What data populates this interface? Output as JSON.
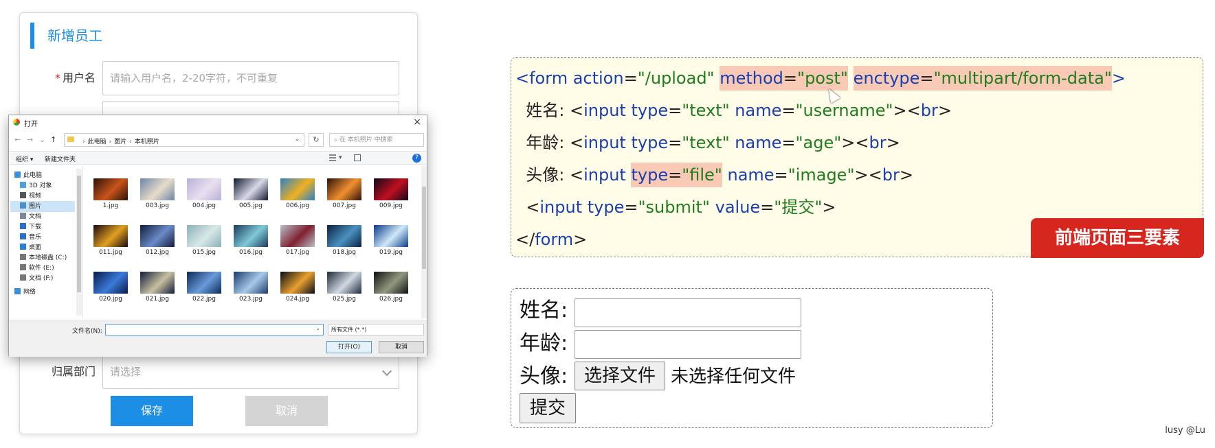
{
  "employee_form": {
    "title": "新增员工",
    "username_required_mark": "*",
    "username_label": "用户名",
    "username_placeholder": "请输入用户名，2-20字符，不可重复",
    "dept_label": "归属部门",
    "dept_placeholder": "请选择",
    "save_label": "保存",
    "cancel_label": "取消"
  },
  "file_dialog": {
    "title": "打开",
    "close": "×",
    "address": [
      "此电脑",
      "图片",
      "本机照片"
    ],
    "search_placeholder": "在 本机照片 中搜索",
    "toolbar_organize": "组织 ▾",
    "toolbar_new_folder": "新建文件夹",
    "sidebar": [
      {
        "label": "此电脑",
        "icon": "pc-icon",
        "color": "#3b8fd8"
      },
      {
        "label": "3D 对象",
        "icon": "cube-icon",
        "color": "#4aa3df"
      },
      {
        "label": "视频",
        "icon": "video-icon",
        "color": "#555555"
      },
      {
        "label": "图片",
        "icon": "picture-icon",
        "color": "#4a90c8"
      },
      {
        "label": "文档",
        "icon": "document-icon",
        "color": "#7a8a9a"
      },
      {
        "label": "下载",
        "icon": "download-icon",
        "color": "#2a6fc9"
      },
      {
        "label": "音乐",
        "icon": "music-icon",
        "color": "#2a6fc9"
      },
      {
        "label": "桌面",
        "icon": "desktop-icon",
        "color": "#2a7fd9"
      },
      {
        "label": "本地磁盘 (C:)",
        "icon": "disk-icon",
        "color": "#777777"
      },
      {
        "label": "软件 (E:)",
        "icon": "disk-icon",
        "color": "#777777"
      },
      {
        "label": "文档 (F:)",
        "icon": "disk-icon",
        "color": "#777777"
      },
      {
        "label": "网络",
        "icon": "network-icon",
        "color": "#3b8fd8"
      }
    ],
    "files": [
      {
        "name": "1.jpg",
        "colors": [
          "#2a1208",
          "#c8541a"
        ]
      },
      {
        "name": "003.jpg",
        "colors": [
          "#6a86a8",
          "#e8dcc8"
        ]
      },
      {
        "name": "004.jpg",
        "colors": [
          "#b8b0d8",
          "#e8e0f0"
        ]
      },
      {
        "name": "005.jpg",
        "colors": [
          "#101830",
          "#d8d8e8"
        ]
      },
      {
        "name": "006.jpg",
        "colors": [
          "#2a80c8",
          "#f0b020"
        ]
      },
      {
        "name": "007.jpg",
        "colors": [
          "#301008",
          "#f09030"
        ]
      },
      {
        "name": "009.jpg",
        "colors": [
          "#100818",
          "#c01020"
        ]
      },
      {
        "name": "011.jpg",
        "colors": [
          "#180810",
          "#e0a020"
        ]
      },
      {
        "name": "012.jpg",
        "colors": [
          "#101c3a",
          "#6a8ac8"
        ]
      },
      {
        "name": "015.jpg",
        "colors": [
          "#8ab0b8",
          "#d8e8e8"
        ]
      },
      {
        "name": "016.jpg",
        "colors": [
          "#1a3a5a",
          "#80c8d8"
        ]
      },
      {
        "name": "017.jpg",
        "colors": [
          "#b8c0c8",
          "#802030"
        ]
      },
      {
        "name": "018.jpg",
        "colors": [
          "#0a2040",
          "#4a90c0"
        ]
      },
      {
        "name": "019.jpg",
        "colors": [
          "#0a3a8a",
          "#d0e8f8"
        ]
      },
      {
        "name": "020.jpg",
        "colors": [
          "#0a1a4a",
          "#3a7ad8"
        ]
      },
      {
        "name": "021.jpg",
        "colors": [
          "#101c3a",
          "#c8c0a0"
        ]
      },
      {
        "name": "022.jpg",
        "colors": [
          "#0a2a5a",
          "#6a9ad8"
        ]
      },
      {
        "name": "023.jpg",
        "colors": [
          "#1a3a6a",
          "#a8c8e8"
        ]
      },
      {
        "name": "024.jpg",
        "colors": [
          "#080c18",
          "#e8a030"
        ]
      },
      {
        "name": "025.jpg",
        "colors": [
          "#1a2a3a",
          "#d0d8e0"
        ]
      },
      {
        "name": "026.jpg",
        "colors": [
          "#101010",
          "#909880"
        ]
      }
    ],
    "filename_label": "文件名(N):",
    "filetype": "所有文件 (*.*)",
    "open_label": "打开(O)",
    "cancel_label": "取消"
  },
  "code": {
    "badge": "前端页面三要素",
    "highlight_color": "#f8c9b4"
  },
  "rendered_form": {
    "name_label": "姓名:",
    "age_label": "年龄:",
    "avatar_label": "头像:",
    "choose_file": "选择文件",
    "no_file": "未选择任何文件",
    "submit": "提交"
  },
  "watermark": "lusy @Lu"
}
